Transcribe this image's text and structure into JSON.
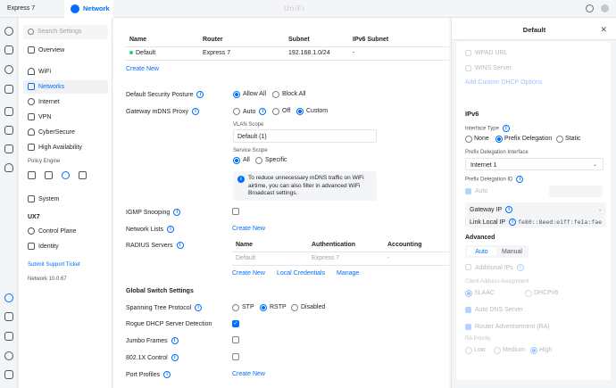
{
  "topbar": {
    "device": "Express 7",
    "tab": "Network",
    "brand": "UniFi"
  },
  "nav": {
    "search_placeholder": "Search Settings",
    "items": [
      {
        "label": "Overview"
      },
      {
        "label": "WiFi"
      },
      {
        "label": "Networks"
      },
      {
        "label": "Internet"
      },
      {
        "label": "VPN"
      },
      {
        "label": "CyberSecure"
      },
      {
        "label": "High Availability"
      }
    ],
    "policy_engine": "Policy Engine",
    "system": "System",
    "ux7": "UX7",
    "ux_items": [
      {
        "label": "Control Plane"
      },
      {
        "label": "Identity"
      }
    ],
    "support_link": "Submit Support Ticket",
    "version": "Network 10.0.67"
  },
  "networks": {
    "headers": [
      "Name",
      "Router",
      "Subnet",
      "IPv6 Subnet"
    ],
    "rows": [
      {
        "name": "Default",
        "router": "Express 7",
        "subnet": "192.168.1.0/24",
        "ipv6": "-"
      }
    ],
    "create_new": "Create New"
  },
  "settings": {
    "security_posture": {
      "label": "Default Security Posture",
      "options": [
        "Allow All",
        "Block All"
      ]
    },
    "mdns": {
      "label": "Gateway mDNS Proxy",
      "options": [
        "Auto",
        "Off",
        "Custom"
      ]
    },
    "vlan_scope": {
      "label": "VLAN Scope",
      "value": "Default (1)"
    },
    "service_scope": {
      "label": "Service Scope",
      "options": [
        "All",
        "Specific"
      ]
    },
    "note": "To reduce unnecessary mDNS traffic on WiFi airtime, you can also filter in advanced WiFi Broadcast settings.",
    "igmp": "IGMP Snooping",
    "network_lists": {
      "label": "Network Lists",
      "action": "Create New"
    },
    "radius": {
      "label": "RADIUS Servers",
      "headers": [
        "Name",
        "Authentication",
        "Accounting"
      ],
      "row": {
        "name": "Default",
        "auth": "Express 7",
        "acct": "-"
      },
      "actions": [
        "Create New",
        "Local Credentials",
        "Manage"
      ]
    },
    "global_switch": "Global Switch Settings",
    "stp": {
      "label": "Spanning Tree Protocol",
      "options": [
        "STP",
        "RSTP",
        "Disabled"
      ]
    },
    "rogue_dhcp": "Rogue DHCP Server Detection",
    "jumbo": "Jumbo Frames",
    "dot1x": "802.1X Control",
    "port_profiles": {
      "label": "Port Profiles",
      "action": "Create New"
    }
  },
  "panel": {
    "title": "Default",
    "wpad": "WPAD URL",
    "wins": "WINS Server",
    "add_dhcp": "Add Custom DHCP Options",
    "ipv6": {
      "title": "IPv6",
      "interface_type_label": "Interface Type",
      "interface_types": [
        "None",
        "Prefix Delegation",
        "Static"
      ],
      "pd_interface_label": "Prefix Delegation Interface",
      "pd_interface": "Internet 1",
      "pd_id_label": "Prefix Delegation ID",
      "auto": "Auto",
      "gateway_ip_label": "Gateway IP",
      "gateway_ip": "-",
      "link_local_label": "Link Local IP",
      "link_local": "fe80::8eed:e1ff:fe1a:fae"
    },
    "advanced": {
      "title": "Advanced",
      "tabs": [
        "Auto",
        "Manual"
      ],
      "additional_ips": "Additional IPs",
      "client_assignment_label": "Client Address Assignment",
      "client_assignment": [
        "SLAAC",
        "DHCPv6"
      ],
      "auto_dns": "Auto DNS Server",
      "router_adv": "Router Advertisement (RA)",
      "ra_priority_label": "RA Priority",
      "ra_priority": [
        "Low",
        "Medium",
        "High"
      ]
    }
  },
  "colors": {
    "accent": "#006fff",
    "text": "#212327",
    "muted": "#50565e",
    "bg": "#f4f5f6",
    "border": "#e4e5e7",
    "success": "#38c976"
  }
}
